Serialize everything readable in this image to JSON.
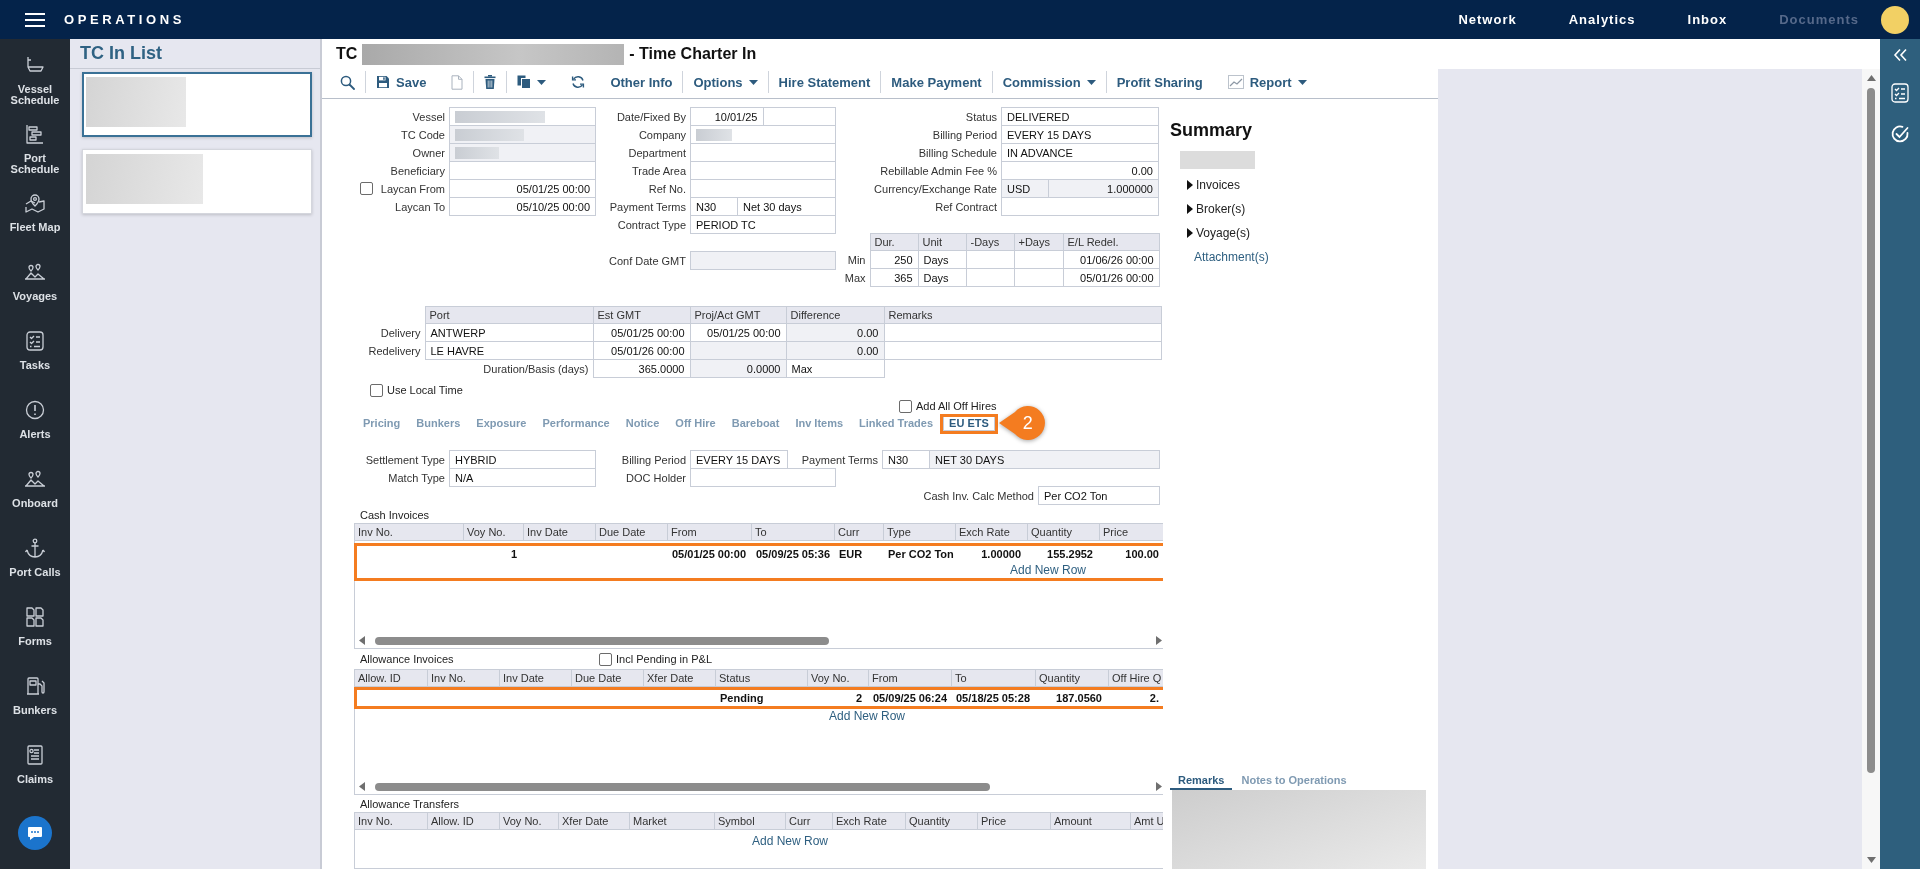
{
  "top_bar": {
    "app_title": "OPERATIONS",
    "links": [
      {
        "label": "Network",
        "disabled": false
      },
      {
        "label": "Analytics",
        "disabled": false
      },
      {
        "label": "Inbox",
        "disabled": false
      },
      {
        "label": "Documents",
        "disabled": true
      }
    ]
  },
  "side_nav": [
    {
      "label": "Vessel Schedule"
    },
    {
      "label": "Port Schedule"
    },
    {
      "label": "Fleet Map"
    },
    {
      "label": "Voyages"
    },
    {
      "label": "Tasks"
    },
    {
      "label": "Alerts"
    },
    {
      "label": "Onboard"
    },
    {
      "label": "Port Calls"
    },
    {
      "label": "Forms"
    },
    {
      "label": "Bunkers"
    },
    {
      "label": "Claims"
    }
  ],
  "list_panel": {
    "title": "TC In List",
    "items": [
      {
        "selected": true,
        "redacted": true
      },
      {
        "selected": false,
        "redacted": true
      }
    ]
  },
  "header": {
    "title_prefix": "TC",
    "title_redacted": true,
    "title_suffix": "- Time Charter In"
  },
  "toolbar": [
    [
      {
        "kind": "icon",
        "disabled": false
      }
    ],
    [
      {
        "kind": "icon_label",
        "label": "Save",
        "disabled": false
      },
      {
        "kind": "icon",
        "disabled": true
      }
    ],
    [
      {
        "kind": "icon",
        "disabled": false
      }
    ],
    [
      {
        "kind": "icon_menu",
        "disabled": false
      },
      {
        "kind": "icon",
        "disabled": false
      },
      {
        "kind": "label",
        "label": "Other Info",
        "disabled": false
      }
    ],
    [
      {
        "kind": "menu",
        "label": "Options",
        "disabled": false
      }
    ],
    [
      {
        "kind": "label",
        "label": "Hire Statement",
        "disabled": false
      }
    ],
    [
      {
        "kind": "label",
        "label": "Make Payment",
        "disabled": false
      }
    ],
    [
      {
        "kind": "menu",
        "label": "Commission",
        "disabled": false
      }
    ],
    [
      {
        "kind": "label",
        "label": "Profit Sharing",
        "disabled": false
      },
      {
        "kind": "icon_label_menu",
        "label": "Report",
        "disabled": false
      }
    ]
  ],
  "contract_form": {
    "left_fields": [
      {
        "label": "Vessel",
        "inputs": [
          {
            "kind": "text",
            "readonly": false,
            "redacted": true
          }
        ]
      },
      {
        "label": "TC Code",
        "inputs": [
          {
            "kind": "text",
            "readonly": true,
            "redacted": true
          }
        ]
      },
      {
        "label": "Owner",
        "inputs": [
          {
            "kind": "text",
            "readonly": true,
            "redacted": true
          }
        ]
      },
      {
        "label": "Beneficiary",
        "inputs": [
          {
            "kind": "text",
            "readonly": false
          }
        ]
      },
      {
        "label": "Laycan From",
        "checked": false,
        "inputs": [
          {
            "kind": "date",
            "value": "05/01/25 00:00",
            "readonly": false
          }
        ]
      },
      {
        "label": "Laycan To",
        "inputs": [
          {
            "kind": "date",
            "value": "05/10/25 00:00",
            "readonly": false
          }
        ]
      }
    ],
    "middle_fields": [
      {
        "label": "Date/Fixed By",
        "inputs": [
          {
            "kind": "date",
            "value": "10/01/25",
            "readonly": false
          },
          {
            "kind": "text",
            "readonly": false
          }
        ]
      },
      {
        "label": "Company",
        "inputs": [
          {
            "kind": "text",
            "readonly": false,
            "redacted": true
          }
        ]
      },
      {
        "label": "Department",
        "inputs": [
          {
            "kind": "text",
            "readonly": false
          }
        ]
      },
      {
        "label": "Trade Area",
        "inputs": [
          {
            "kind": "text",
            "readonly": false
          }
        ]
      },
      {
        "label": "Ref No.",
        "inputs": [
          {
            "kind": "text",
            "readonly": false
          }
        ]
      },
      {
        "label": "Payment Terms",
        "inputs": [
          {
            "kind": "code",
            "value": "N30",
            "readonly": false
          },
          {
            "kind": "text",
            "value": "Net 30 days",
            "readonly": false
          }
        ]
      },
      {
        "label": "Contract Type",
        "inputs": [
          {
            "kind": "text",
            "value": "PERIOD TC",
            "readonly": false
          }
        ]
      },
      {
        "label": "Conf Date GMT",
        "inputs": [
          {
            "kind": "text",
            "readonly": true
          }
        ]
      }
    ],
    "right_fields": [
      {
        "label": "Status",
        "inputs": [
          {
            "kind": "text",
            "value": "DELIVERED",
            "readonly": false
          }
        ]
      },
      {
        "label": "Billing Period",
        "inputs": [
          {
            "kind": "text",
            "value": "EVERY 15 DAYS",
            "readonly": false
          }
        ]
      },
      {
        "label": "Billing Schedule",
        "inputs": [
          {
            "kind": "text",
            "value": "IN ADVANCE",
            "readonly": false
          }
        ]
      },
      {
        "label": "Rebillable Admin Fee %",
        "inputs": [
          {
            "kind": "number",
            "value": "0.00",
            "readonly": false
          }
        ]
      },
      {
        "label": "Currency/Exchange Rate",
        "inputs": [
          {
            "kind": "code",
            "value": "USD",
            "readonly": true
          },
          {
            "kind": "number",
            "value": "1.000000",
            "readonly": true
          }
        ]
      },
      {
        "label": "Ref Contract",
        "inputs": [
          {
            "kind": "text",
            "readonly": false
          }
        ]
      }
    ]
  },
  "duration_limits": {
    "columns": [
      "Dur.",
      "Unit",
      "-Days",
      "+Days",
      "E/L Redel."
    ],
    "rows": [
      {
        "label": "Min",
        "cells": [
          "250",
          "Days",
          null,
          null,
          "01/06/26 00:00"
        ]
      },
      {
        "label": "Max",
        "cells": [
          "365",
          "Days",
          null,
          null,
          "05/01/26 00:00"
        ]
      }
    ]
  },
  "delivery_table": {
    "columns": [
      "Port",
      "Est GMT",
      "Proj/Act GMT",
      "Difference",
      "Remarks"
    ],
    "rows": [
      {
        "label": "Delivery",
        "cells": [
          {
            "value": "ANTWERP",
            "readonly": false
          },
          {
            "value": "05/01/25 00:00",
            "readonly": false
          },
          {
            "value": "05/01/25 00:00",
            "readonly": false
          },
          {
            "value": "0.00",
            "readonly": true
          },
          {
            "readonly": false
          }
        ]
      },
      {
        "label": "Redelivery",
        "cells": [
          {
            "value": "LE HAVRE",
            "readonly": false
          },
          {
            "value": "05/01/26 00:00",
            "readonly": false
          },
          {
            "readonly": true
          },
          {
            "value": "0.00",
            "readonly": true
          },
          {
            "readonly": false
          }
        ]
      }
    ],
    "duration_row": {
      "label": "Duration/Basis (days)",
      "cells": [
        {
          "value": "365.0000",
          "readonly": false
        },
        {
          "value": "0.0000",
          "readonly": true
        },
        {
          "value": "Max",
          "readonly": false
        }
      ]
    }
  },
  "use_local_time": {
    "label": "Use Local Time",
    "checked": false
  },
  "add_all_off_hires": {
    "label": "Add All Off Hires",
    "checked": false
  },
  "detail_tabs": [
    {
      "label": "Pricing",
      "selected": false,
      "highlighted": false
    },
    {
      "label": "Bunkers",
      "selected": false,
      "highlighted": false
    },
    {
      "label": "Exposure",
      "selected": false,
      "highlighted": false
    },
    {
      "label": "Performance",
      "selected": false,
      "highlighted": false
    },
    {
      "label": "Notice",
      "selected": false,
      "highlighted": false
    },
    {
      "label": "Off Hire",
      "selected": false,
      "highlighted": false
    },
    {
      "label": "Bareboat",
      "selected": false,
      "highlighted": false
    },
    {
      "label": "Inv Items",
      "selected": false,
      "highlighted": false
    },
    {
      "label": "Linked Trades",
      "selected": false,
      "highlighted": false
    },
    {
      "label": "EU ETS",
      "selected": true,
      "highlighted": true,
      "callout": "2"
    }
  ],
  "eu_ets": {
    "settings": [
      {
        "label": "Settlement Type",
        "inputs": [
          {
            "kind": "text",
            "value": "HYBRID",
            "readonly": false
          }
        ]
      },
      {
        "label": "Billing Period",
        "inputs": [
          {
            "kind": "text",
            "value": "EVERY 15 DAYS",
            "readonly": false
          }
        ]
      },
      {
        "label": "Payment Terms",
        "inputs": [
          {
            "kind": "code",
            "value": "N30",
            "readonly": false
          },
          {
            "kind": "text",
            "value": "NET 30 DAYS",
            "readonly": true
          }
        ]
      },
      {
        "label": "Match Type",
        "inputs": [
          {
            "kind": "text",
            "value": "N/A",
            "readonly": false
          }
        ]
      },
      {
        "label": "DOC Holder",
        "inputs": [
          {
            "kind": "text",
            "readonly": false
          }
        ]
      },
      {
        "label": "Cash Inv. Calc Method",
        "inputs": [
          {
            "kind": "text",
            "value": "Per CO2 Ton",
            "readonly": false
          }
        ]
      }
    ],
    "cash_invoices": {
      "title": "Cash Invoices",
      "columns": [
        "Inv No.",
        "Voy No.",
        "Inv Date",
        "Due Date",
        "From",
        "To",
        "Curr",
        "Type",
        "Exch Rate",
        "Quantity",
        "Price"
      ],
      "rows": [
        {
          "cells": [
            null,
            "1",
            null,
            null,
            "05/01/25 00:00",
            "05/09/25 05:36",
            "EUR",
            "Per CO2 Ton",
            "1.00000",
            "155.2952",
            "100.00"
          ],
          "highlighted": true
        }
      ],
      "add_row_label": "Add New Row",
      "highlight_covers_add_row": true
    },
    "allowance_invoices": {
      "title": "Allowance Invoices",
      "option": {
        "label": "Incl Pending in P&L",
        "checked": false
      },
      "columns": [
        "Allow. ID",
        "Inv No.",
        "Inv Date",
        "Due Date",
        "Xfer Date",
        "Status",
        "Voy No.",
        "From",
        "To",
        "Quantity",
        "Off Hire Q"
      ],
      "rows": [
        {
          "cells": [
            null,
            null,
            null,
            null,
            null,
            "Pending",
            "2",
            "05/09/25 06:24",
            "05/18/25 05:28",
            "187.0560",
            "2."
          ],
          "highlighted": true
        }
      ],
      "add_row_label": "Add New Row",
      "highlight_covers_add_row": false
    },
    "allowance_transfers": {
      "title": "Allowance Transfers",
      "columns": [
        "Inv No.",
        "Allow. ID",
        "Voy No.",
        "Xfer Date",
        "Market",
        "Symbol",
        "Curr",
        "Exch Rate",
        "Quantity",
        "Price",
        "Amount",
        "Amt U"
      ],
      "add_row_label": "Add New Row"
    }
  },
  "summary": {
    "title": "Summary",
    "redacted": true,
    "items": [
      {
        "label": "Invoices",
        "kind": "expandable",
        "expanded": false
      },
      {
        "label": "Broker(s)",
        "kind": "expandable",
        "expanded": false
      },
      {
        "label": "Voyage(s)",
        "kind": "expandable",
        "expanded": false
      },
      {
        "label": "Attachment(s)",
        "kind": "link"
      }
    ]
  },
  "remarks": {
    "tabs": [
      {
        "label": "Remarks",
        "selected": true
      },
      {
        "label": "Notes to Operations",
        "selected": false
      }
    ],
    "redacted": true
  }
}
